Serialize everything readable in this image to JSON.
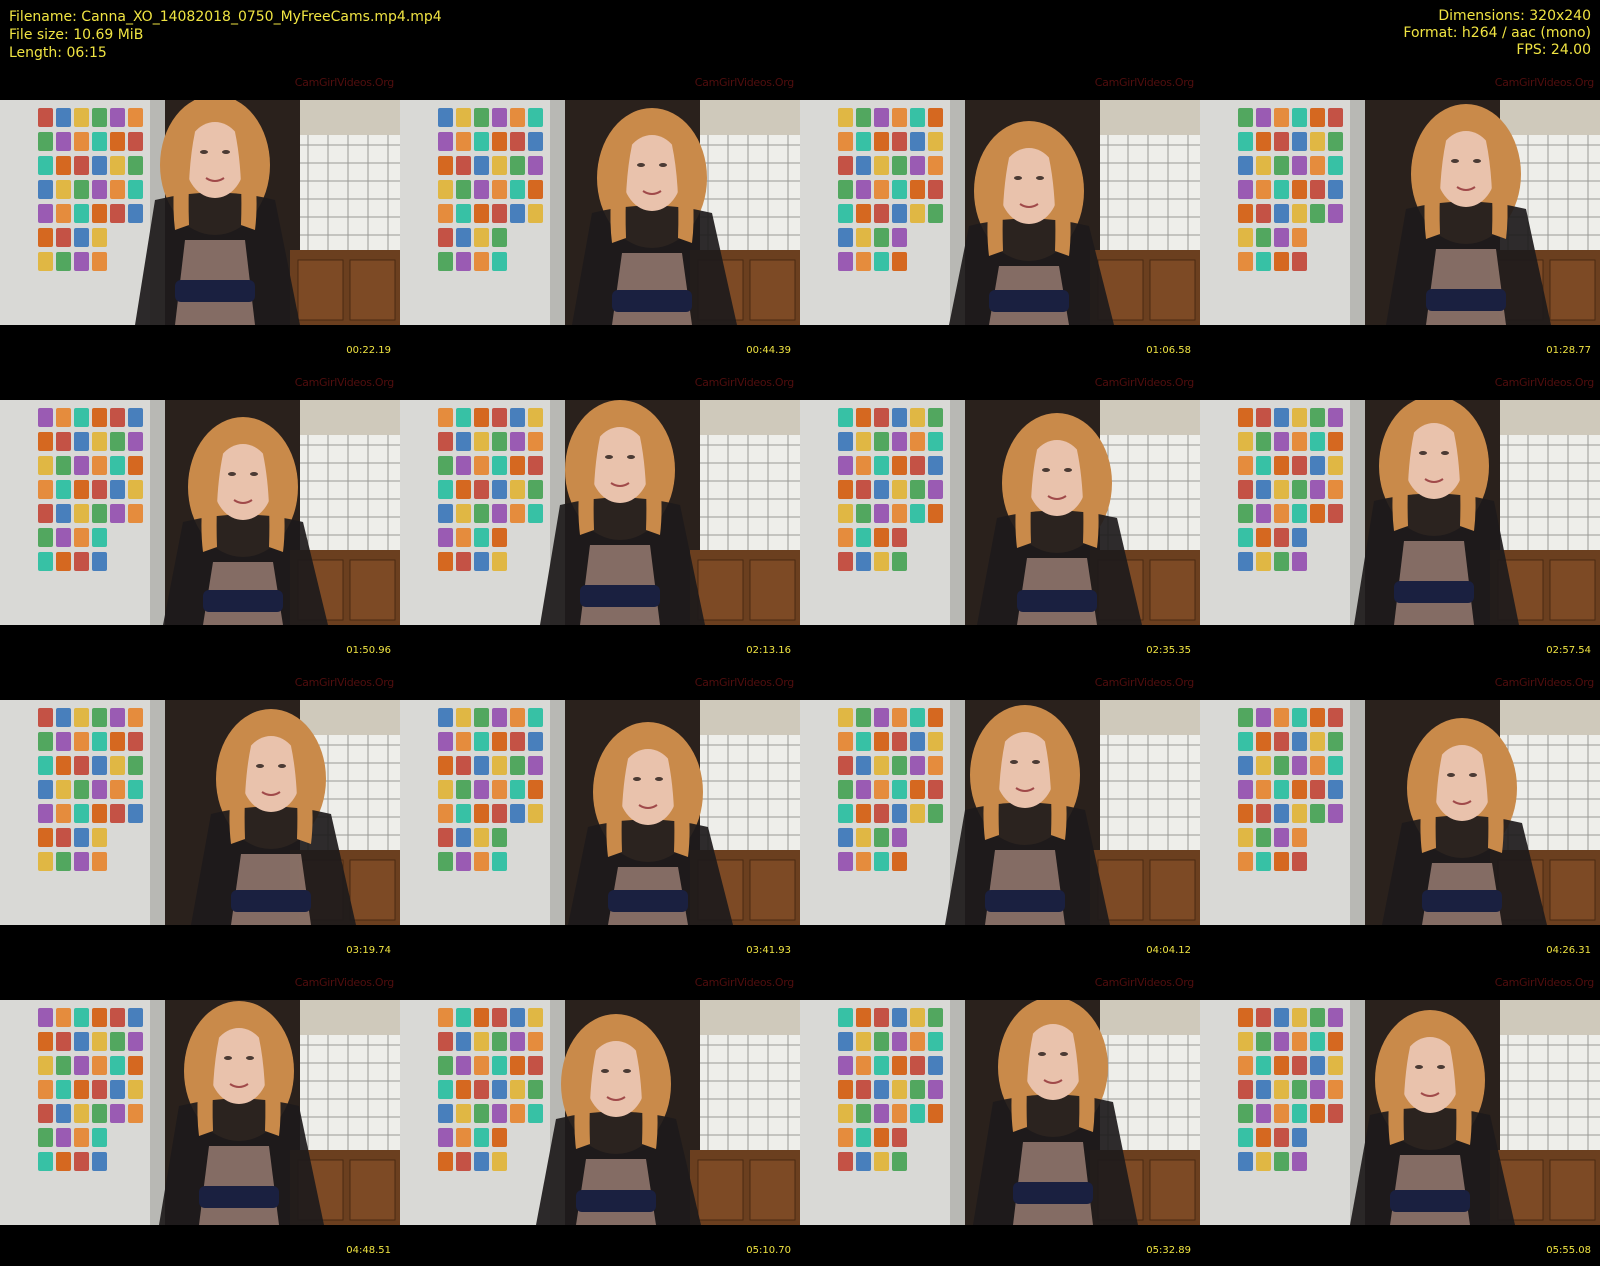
{
  "header": {
    "filename": "Filename: Canna_XO_14082018_0750_MyFreeCams.mp4.mp4",
    "filesize": "File size: 10.69 MiB",
    "length": "Length: 06:15",
    "dimensions": "Dimensions: 320x240",
    "format": "Format: h264 / aac (mono)",
    "fps": "FPS: 24.00"
  },
  "watermark": "CamGirlVideos.Org",
  "colors": {
    "text": "#f0e442",
    "background": "#000000",
    "watermark": "#5a1010"
  },
  "thumbnails": [
    {
      "timestamp": "00:22.19"
    },
    {
      "timestamp": "00:44.39"
    },
    {
      "timestamp": "01:06.58"
    },
    {
      "timestamp": "01:28.77"
    },
    {
      "timestamp": "01:50.96"
    },
    {
      "timestamp": "02:13.16"
    },
    {
      "timestamp": "02:35.35"
    },
    {
      "timestamp": "02:57.54"
    },
    {
      "timestamp": "03:19.74"
    },
    {
      "timestamp": "03:41.93"
    },
    {
      "timestamp": "04:04.12"
    },
    {
      "timestamp": "04:26.31"
    },
    {
      "timestamp": "04:48.51"
    },
    {
      "timestamp": "05:10.70"
    },
    {
      "timestamp": "05:32.89"
    },
    {
      "timestamp": "05:55.08"
    }
  ]
}
